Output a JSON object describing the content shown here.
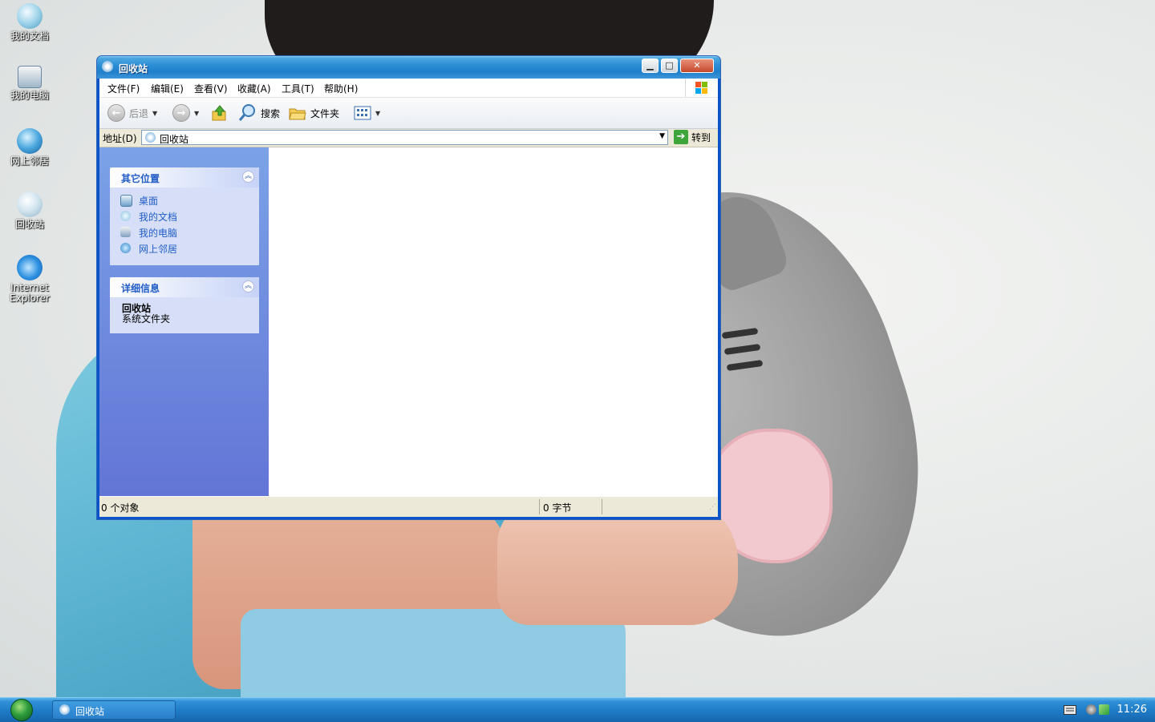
{
  "desktop": {
    "icons": [
      {
        "label": "我的文档",
        "icon": "my-documents-icon"
      },
      {
        "label": "我的电脑",
        "icon": "my-computer-icon"
      },
      {
        "label": "网上邻居",
        "icon": "network-places-icon"
      },
      {
        "label": "回收站",
        "icon": "recycle-bin-icon"
      },
      {
        "label_line1": "Internet",
        "label_line2": "Explorer",
        "icon": "internet-explorer-icon"
      }
    ]
  },
  "window": {
    "title": "回收站",
    "controls": {
      "minimize": "▁",
      "maximize": "□",
      "close": "✕"
    },
    "menu": [
      "文件(F)",
      "编辑(E)",
      "查看(V)",
      "收藏(A)",
      "工具(T)",
      "帮助(H)"
    ],
    "toolbar": {
      "back": "后退",
      "search": "搜索",
      "folders": "文件夹"
    },
    "address": {
      "label": "地址(D)",
      "value": "回收站",
      "go": "转到"
    },
    "left_pane": {
      "other_places": {
        "title": "其它位置",
        "links": [
          "桌面",
          "我的文档",
          "我的电脑",
          "网上邻居"
        ]
      },
      "details": {
        "title": "详细信息",
        "name": "回收站",
        "type": "系统文件夹"
      }
    },
    "status": {
      "objects": "0 个对象",
      "size": "0 字节"
    }
  },
  "taskbar": {
    "task": "回收站",
    "clock": "11:26"
  },
  "colors": {
    "title_blue": "#2b8ed6",
    "link_blue": "#215dc6",
    "pane_top": "#7ba2e7",
    "pane_bottom": "#6375d6",
    "taskbar": "#1d78c4"
  }
}
